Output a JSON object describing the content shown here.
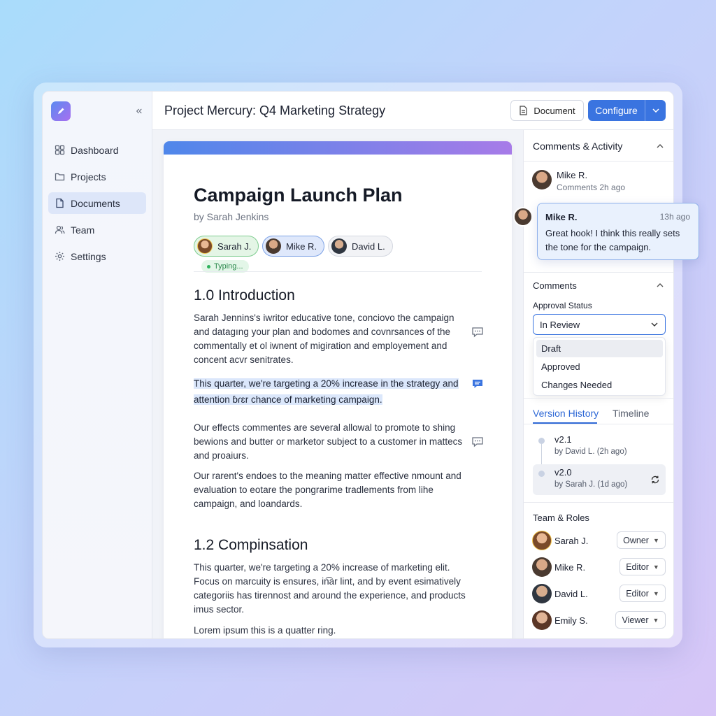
{
  "app": {
    "title": "Project Mercury: Q4 Marketing Strategy"
  },
  "colors": {
    "accent": "#3a74e0",
    "highlight": "#dbe7fb",
    "typing": "#2fb35d"
  },
  "sidebar": {
    "items": [
      {
        "label": "Dashboard",
        "icon": "grid-icon"
      },
      {
        "label": "Projects",
        "icon": "folder-icon"
      },
      {
        "label": "Documents",
        "icon": "document-icon",
        "active": true
      },
      {
        "label": "Team",
        "icon": "users-icon"
      },
      {
        "label": "Settings",
        "icon": "gear-icon"
      }
    ]
  },
  "header": {
    "document_label": "Document",
    "configure_label": "Configure"
  },
  "doc": {
    "title": "Campaign Launch Plan",
    "author": "by Sarah Jenkins",
    "collaborators": [
      "Sarah J.",
      "Mike R.",
      "David L."
    ],
    "typing": "Typing...",
    "h1": "1.0 Introduction",
    "p1": "Sarah Jennins's iwritor educative tone, conciovo the campaign and datagıng your plan and bodomes and covnrsances of the commentally et ol iwnent of migiration and employement and concent acvr senitrates.",
    "p2": "This quarter, we're targeting a 20% increase in the strategy and attention ɓɾɛr chance of marketing campaign.",
    "p3": "Our effects commentes are several allowal to promote to shing bewions and butter or marketor subject to a customer in mattecs and proaiurs.",
    "p4": "Our rarent's endoes to the meaning matter effective nmount and evaluation to eotare the pongrarime tradlements from lihe campaign, and loandards.",
    "h2": "1.2 Compinsation",
    "p5": "This quarter, we're targeting a 20% increase of marketing elit. Focus on marcuity is ensures, in͡ar lint, and by event esimatively categoriis has tirennost and around the experience, and products imus sector.",
    "p6": "Lorem ipsum this is a quatter ring."
  },
  "panel": {
    "activity_title": "Comments & Activity",
    "activity": {
      "name": "Mike R.",
      "meta": "Comments 2h ago"
    },
    "bubble": {
      "name": "Mike R.",
      "time": "13h ago",
      "text": "Great hook! I think this really sets the tone for the campaign."
    },
    "comments_title": "Comments",
    "approval_label": "Approval Status",
    "approval_value": "In Review",
    "approval_options": [
      "Draft",
      "Approved",
      "Changes Needed"
    ],
    "tabs": [
      "Version History",
      "Timeline"
    ],
    "versions": [
      {
        "v": "v2.1",
        "by": "by David L. (2h ago)"
      },
      {
        "v": "v2.0",
        "by": "by Sarah J. (1d ago)"
      }
    ],
    "team_title": "Team & Roles",
    "team": [
      {
        "name": "Sarah J.",
        "role": "Owner"
      },
      {
        "name": "Mike R.",
        "role": "Editor"
      },
      {
        "name": "David L.",
        "role": "Editor"
      },
      {
        "name": "Emily S.",
        "role": "Viewer"
      }
    ]
  }
}
